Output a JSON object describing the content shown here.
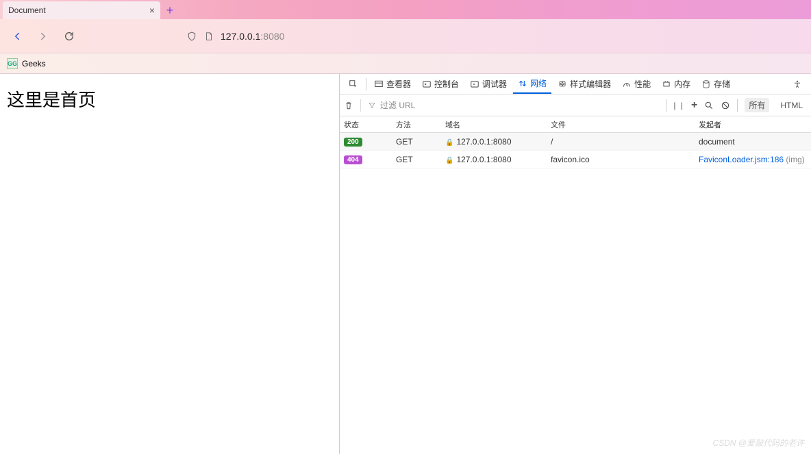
{
  "browser": {
    "tab_title": "Document",
    "bookmark_label": "Geeks",
    "bookmark_icon_text": "GG",
    "url_host": "127.0.0.1",
    "url_port": ":8080"
  },
  "page": {
    "heading": "这里是首页"
  },
  "devtools": {
    "tabs": {
      "inspector": "查看器",
      "console": "控制台",
      "debugger": "调试器",
      "network": "网络",
      "styles": "样式编辑器",
      "perf": "性能",
      "memory": "内存",
      "storage": "存储"
    },
    "filter_placeholder": "过滤 URL",
    "type_all": "所有",
    "type_html": "HTML",
    "columns": {
      "status": "状态",
      "method": "方法",
      "domain": "域名",
      "file": "文件",
      "initiator": "发起者"
    },
    "rows": [
      {
        "status_code": "200",
        "status_class": "s200",
        "method": "GET",
        "domain": "127.0.0.1:8080",
        "file": "/",
        "initiator_plain": "document"
      },
      {
        "status_code": "404",
        "status_class": "s404",
        "method": "GET",
        "domain": "127.0.0.1:8080",
        "file": "favicon.ico",
        "initiator_link": "FaviconLoader.jsm",
        "initiator_line": ":186",
        "initiator_suffix": " (img)"
      }
    ]
  },
  "watermark": "CSDN @爱敲代码的老许"
}
